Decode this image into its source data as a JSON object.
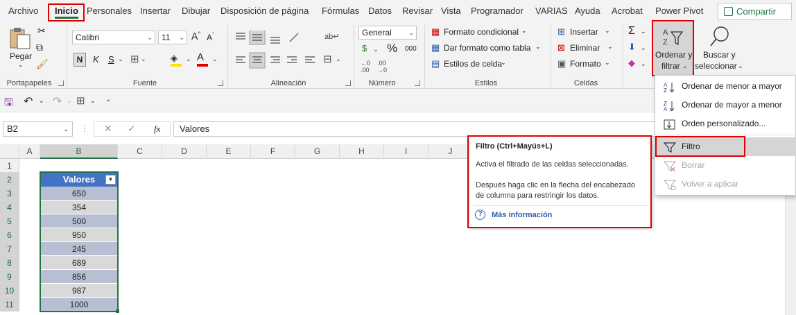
{
  "tabs": [
    "Archivo",
    "Inicio",
    "Personales",
    "Insertar",
    "Dibujar",
    "Disposición de página",
    "Fórmulas",
    "Datos",
    "Revisar",
    "Vista",
    "Programador",
    "VARIAS",
    "Ayuda",
    "Acrobat",
    "Power Pivot"
  ],
  "share": "Compartir",
  "clipboard": {
    "paste": "Pegar",
    "group": "Portapapeles"
  },
  "font": {
    "name": "Calibri",
    "size": "11",
    "bold": "N",
    "italic": "K",
    "underline": "S",
    "group": "Fuente"
  },
  "alignment": {
    "group": "Alineación"
  },
  "number": {
    "format": "General",
    "currency": "$",
    "percent": "%",
    "thousands": "000",
    "group": "Número"
  },
  "styles": {
    "conditional": "Formato condicional",
    "table": "Dar formato como tabla",
    "cell": "Estilos de celda",
    "group": "Estilos"
  },
  "cells": {
    "insert": "Insertar",
    "delete": "Eliminar",
    "format": "Formato",
    "group": "Celdas"
  },
  "editing": {
    "sort_line1": "Ordenar y",
    "sort_line2": "filtrar",
    "find_line1": "Buscar y",
    "find_line2": "seleccionar"
  },
  "formula": {
    "namebox": "B2",
    "fx": "fx",
    "value": "Valores"
  },
  "columns": [
    "A",
    "B",
    "C",
    "D",
    "E",
    "F",
    "G",
    "H",
    "I",
    "J"
  ],
  "rows": [
    "1",
    "2",
    "3",
    "4",
    "5",
    "6",
    "7",
    "8",
    "9",
    "10",
    "11"
  ],
  "table": {
    "header": "Valores",
    "values": [
      "650",
      "354",
      "500",
      "950",
      "245",
      "689",
      "856",
      "987",
      "1000"
    ]
  },
  "tooltip": {
    "title": "Filtro (Ctrl+Mayús+L)",
    "line1": "Activa el filtrado de las celdas seleccionadas.",
    "line2": "Después haga clic en la flecha del encabezado",
    "line3": "de columna para restringir los datos.",
    "more": "Más información"
  },
  "menu": {
    "asc": "Ordenar de menor a mayor",
    "desc": "Ordenar de mayor a menor",
    "custom": "Orden personalizado...",
    "filter": "Filtro",
    "clear": "Borrar",
    "reapply": "Volver a aplicar"
  },
  "colors": {
    "accent": "#217346",
    "highlight": "#e00000",
    "table_header": "#4472c4"
  }
}
